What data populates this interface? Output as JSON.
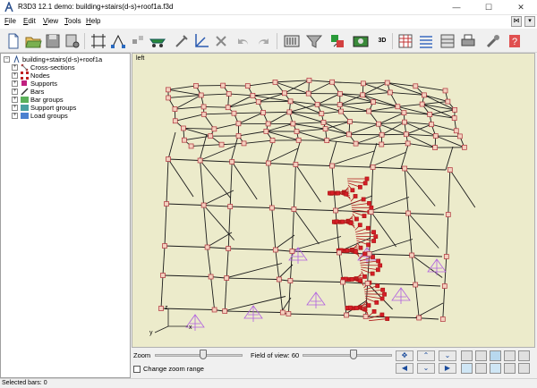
{
  "window": {
    "title": "R3D3 12.1 demo: building+stairs(d-s)+roof1a.f3d",
    "controls": [
      "—",
      "☐",
      "✕"
    ]
  },
  "menu": {
    "items": [
      {
        "label": "File",
        "accel": "F",
        "rest": "ile"
      },
      {
        "label": "Edit",
        "accel": "E",
        "rest": "dit"
      },
      {
        "label": "View",
        "accel": "V",
        "rest": "iew"
      },
      {
        "label": "Tools",
        "accel": "T",
        "rest": "ools"
      },
      {
        "label": "Help",
        "accel": "H",
        "rest": "elp"
      }
    ],
    "right_buttons": [
      "⋈",
      "▾"
    ]
  },
  "toolbar": {
    "icons": [
      "new-file-icon",
      "open-folder-icon",
      "save-icon",
      "settings-sheet-icon",
      "bar-grid-icon",
      "node-connect-icon",
      "move-nodes-icon",
      "support-icon",
      "pin-icon",
      "axes-icon",
      "delete-icon",
      "undo-icon",
      "redo-icon",
      "calculate-icon",
      "filter-icon",
      "results-icon",
      "camera-icon",
      "3d-icon",
      "table-icon",
      "list-icon",
      "spreadsheet-icon",
      "print-icon",
      "tools-icon",
      "help-icon"
    ],
    "label_3d": "3D"
  },
  "tree": {
    "root": "building+stairs(d-s)+roof1a",
    "items": [
      "Cross-sections",
      "Nodes",
      "Supports",
      "Bars",
      "Bar groups",
      "Support groups",
      "Load groups"
    ]
  },
  "viewport": {
    "view_name": "left",
    "axes": {
      "x": "x",
      "y": "y",
      "z": "z"
    },
    "colors": {
      "background": "#ecebcb",
      "bars": "#1a1a1a",
      "nodes_fill": "#f3d0be",
      "nodes_stroke": "#b0303a",
      "stairs": "#d81e28",
      "supports": "#b060e0"
    }
  },
  "bottom": {
    "zoom_label": "Zoom",
    "fov_label": "Field of view: 60",
    "zoom_level": 0.55,
    "fov_level": 0.58,
    "change_zoom_label": "Change zoom range",
    "change_zoom_checked": false,
    "nav_buttons": [
      "✥",
      "⌃",
      "⌄",
      "◀",
      "⌄",
      "▶"
    ]
  },
  "status": {
    "text": "Selected bars: 0"
  }
}
